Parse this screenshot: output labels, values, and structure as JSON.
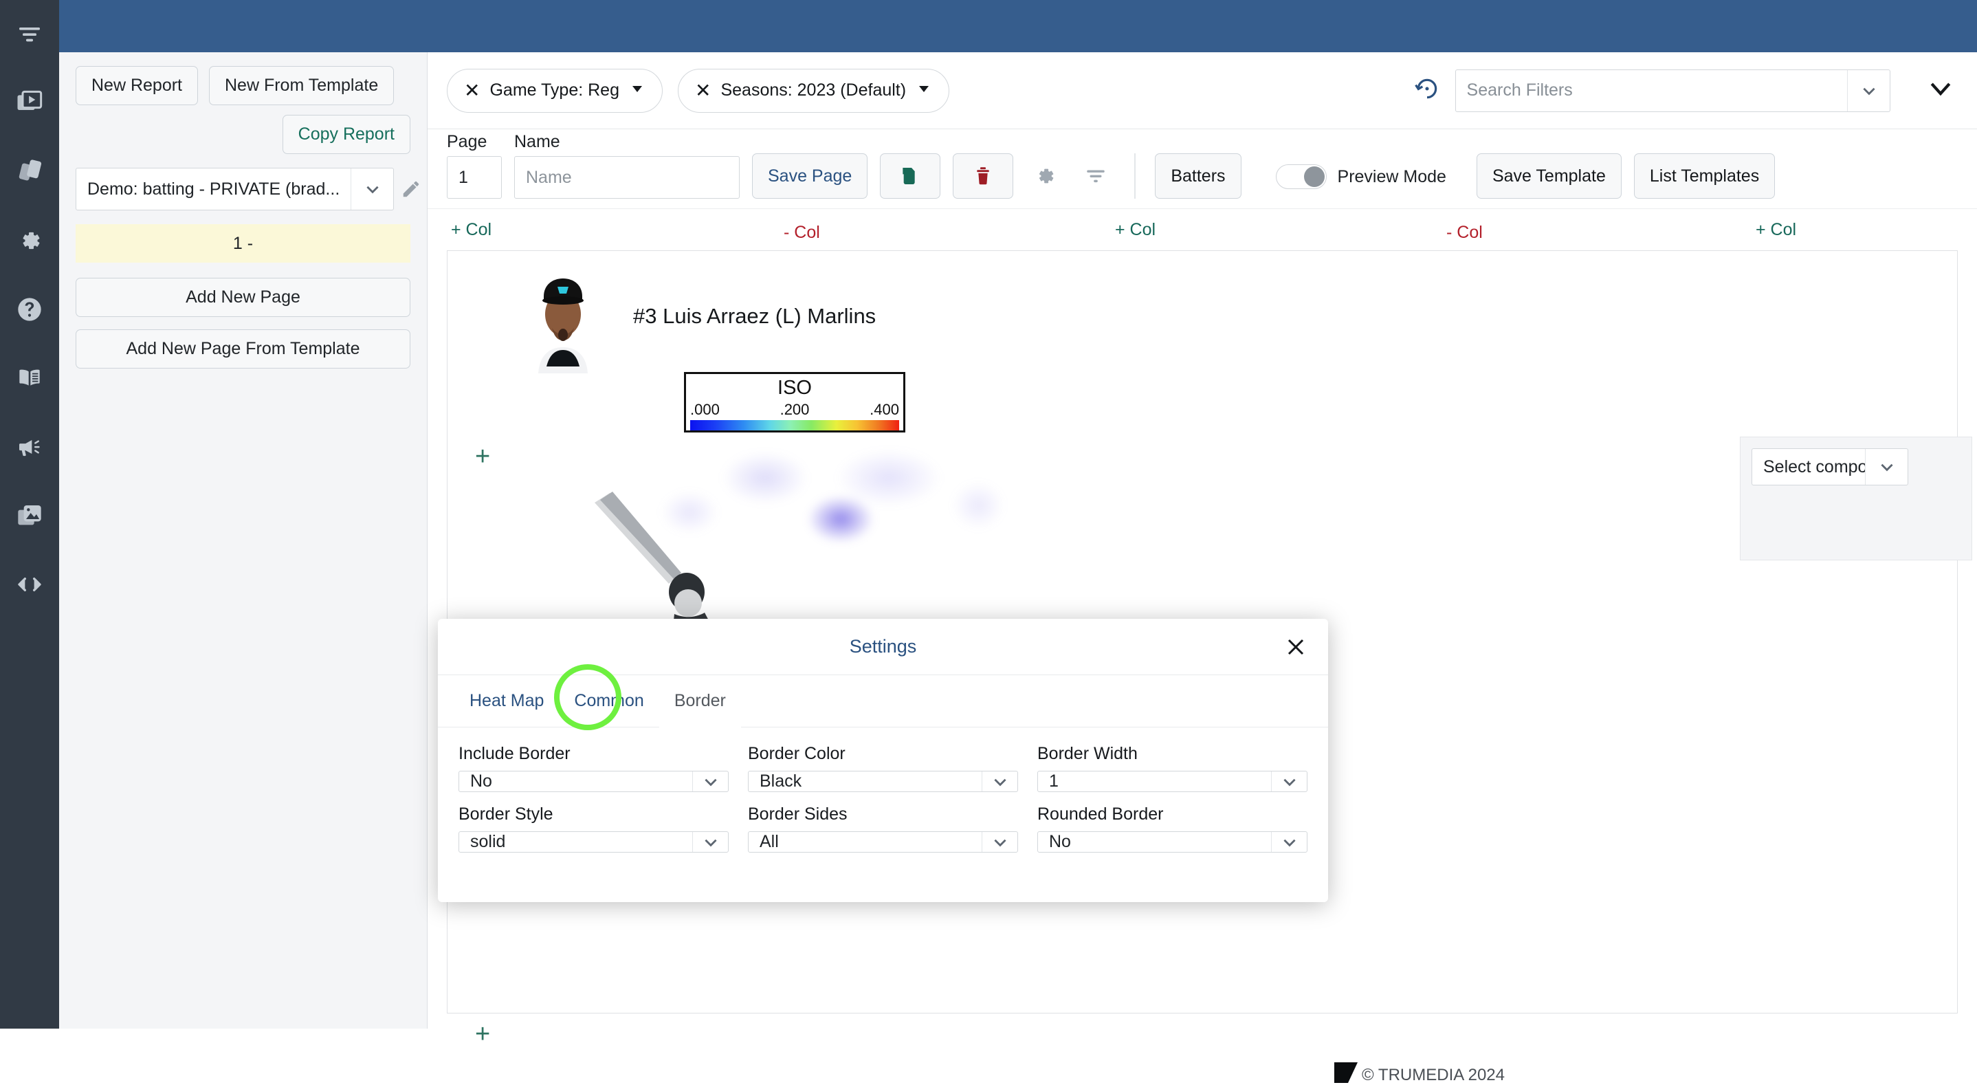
{
  "rail": {
    "items": [
      {
        "name": "menu-toggle-icon",
        "label": "Menu"
      },
      {
        "name": "reports-icon",
        "label": "Reports"
      },
      {
        "name": "cards-icon",
        "label": "Cards"
      },
      {
        "name": "gear-icon",
        "label": "Settings"
      },
      {
        "name": "help-icon",
        "label": "Help"
      },
      {
        "name": "book-icon",
        "label": "Docs"
      },
      {
        "name": "megaphone-icon",
        "label": "Announcements"
      },
      {
        "name": "images-icon",
        "label": "Media"
      },
      {
        "name": "code-icon",
        "label": "Developer"
      }
    ]
  },
  "left_panel": {
    "new_report": "New Report",
    "new_from_template": "New From Template",
    "copy_report": "Copy Report",
    "report_select_value": "Demo: batting - PRIVATE (brad...",
    "page_chip": "1 -",
    "add_new_page": "Add New Page",
    "add_new_page_from_template": "Add New Page From Template"
  },
  "filters": {
    "chips": [
      {
        "label": "Game Type: Reg"
      },
      {
        "label": "Seasons: 2023 (Default)"
      }
    ],
    "search_placeholder": "Search Filters",
    "search_value": ""
  },
  "toolbar": {
    "page_label": "Page",
    "page_value": "1",
    "name_label": "Name",
    "name_value": "",
    "name_placeholder": "Name",
    "save_page": "Save Page",
    "duplicate_icon": "duplicate-icon",
    "delete_icon": "trash-icon",
    "gear_icon": "gear-icon",
    "filter_icon": "filter-icon",
    "batters": "Batters",
    "preview_mode": "Preview Mode",
    "preview_mode_on": false,
    "save_template": "Save Template",
    "list_templates": "List Templates"
  },
  "columns": [
    {
      "label": "+ Col",
      "type": "add"
    },
    {
      "label": "- Col",
      "type": "remove"
    },
    {
      "label": "+ Col",
      "type": "add"
    },
    {
      "label": "- Col",
      "type": "remove"
    },
    {
      "label": "+ Col",
      "type": "add"
    }
  ],
  "canvas": {
    "add_cell_top": "+",
    "add_cell_bottom": "+",
    "player_name": "#3 Luis Arraez (L) Marlins",
    "copyright": "© TRUMEDIA 2024",
    "component_placeholder": "Select component"
  },
  "chart_data": {
    "type": "heatmap",
    "title": "ISO",
    "legend_title": "ISO",
    "tick_labels": [
      ".000",
      ".200",
      ".400"
    ],
    "scale_min": 0.0,
    "scale_mid": 0.2,
    "scale_max": 0.4,
    "colormap": [
      "#0b12f0",
      "#2f8ef2",
      "#5fd6e8",
      "#8cf0b4",
      "#87ea64",
      "#e9f03c",
      "#f7c233",
      "#f07a22",
      "#ef2112"
    ],
    "subject": "#3 Luis Arraez (L) Marlins",
    "description": "Strike-zone ISO heat map with low-ISO (blue) concentration in the lower-middle zone"
  },
  "modal": {
    "title": "Settings",
    "close_icon": "close-icon",
    "tabs": [
      {
        "label": "Heat Map",
        "active": false
      },
      {
        "label": "Common",
        "active": false
      },
      {
        "label": "Border",
        "active": true
      }
    ],
    "highlight_color": "#6ef03f",
    "fields": [
      {
        "label": "Include Border",
        "value": "No"
      },
      {
        "label": "Border Color",
        "value": "Black"
      },
      {
        "label": "Border Width",
        "value": "1"
      },
      {
        "label": "Border Style",
        "value": "solid"
      },
      {
        "label": "Border Sides",
        "value": "All"
      },
      {
        "label": "Rounded Border",
        "value": "No"
      }
    ]
  },
  "colors": {
    "banner": "#365d8d",
    "rail": "#313a45",
    "link": "#2a5180",
    "green": "#17685a",
    "red": "#b3202b",
    "highlight": "#6ef03f"
  }
}
